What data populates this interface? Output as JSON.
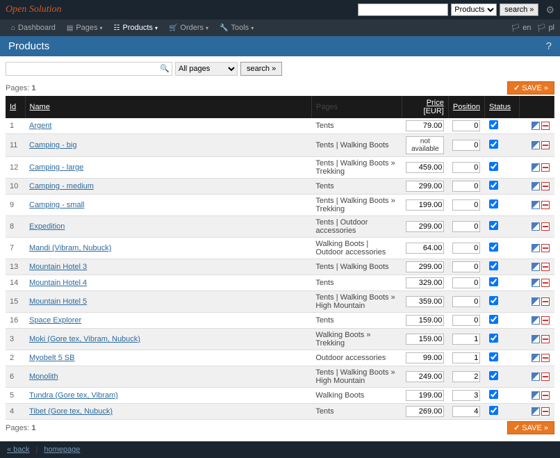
{
  "brand": "Open Solution",
  "top": {
    "search_placeholder": "",
    "type_select": "Products",
    "search_btn": "search »"
  },
  "nav": {
    "items": [
      {
        "label": "Dashboard",
        "dd": false
      },
      {
        "label": "Pages",
        "dd": true
      },
      {
        "label": "Products",
        "dd": true,
        "active": true
      },
      {
        "label": "Orders",
        "dd": true
      },
      {
        "label": "Tools",
        "dd": true
      }
    ],
    "lang": [
      "en",
      "pl"
    ]
  },
  "page": {
    "title": "Products"
  },
  "filter": {
    "pages_select": "All pages",
    "search_btn": "search »"
  },
  "pagination": {
    "label": "Pages:",
    "current": "1"
  },
  "save_btn": "SAVE »",
  "table": {
    "headers": {
      "id": "Id",
      "name": "Name",
      "pages": "Pages",
      "price": "Price",
      "currency": "[EUR]",
      "position": "Position",
      "status": "Status"
    },
    "rows": [
      {
        "id": "1",
        "name": "Argent",
        "pages": "Tents",
        "price": "79.00",
        "position": "0",
        "status": true
      },
      {
        "id": "11",
        "name": "Camping - big",
        "pages": "Tents | Walking Boots",
        "price_na": "not available",
        "position": "0",
        "status": true
      },
      {
        "id": "12",
        "name": "Camping - large",
        "pages": "Tents | Walking Boots » Trekking",
        "price": "459.00",
        "position": "0",
        "status": true
      },
      {
        "id": "10",
        "name": "Camping - medium",
        "pages": "Tents",
        "price": "299.00",
        "position": "0",
        "status": true
      },
      {
        "id": "9",
        "name": "Camping - small",
        "pages": "Tents | Walking Boots » Trekking",
        "price": "199.00",
        "position": "0",
        "status": true
      },
      {
        "id": "8",
        "name": "Expedition",
        "pages": "Tents | Outdoor accessories",
        "price": "299.00",
        "position": "0",
        "status": true
      },
      {
        "id": "7",
        "name": "Mandi (Vibram, Nubuck)",
        "pages": "Walking Boots | Outdoor accessories",
        "price": "64.00",
        "position": "0",
        "status": true
      },
      {
        "id": "13",
        "name": "Mountain Hotel 3",
        "pages": "Tents | Walking Boots",
        "price": "299.00",
        "position": "0",
        "status": true
      },
      {
        "id": "14",
        "name": "Mountain Hotel 4",
        "pages": "Tents",
        "price": "329.00",
        "position": "0",
        "status": true
      },
      {
        "id": "15",
        "name": "Mountain Hotel 5",
        "pages": "Tents | Walking Boots » High Mountain",
        "price": "359.00",
        "position": "0",
        "status": true
      },
      {
        "id": "16",
        "name": "Space Explorer",
        "pages": "Tents",
        "price": "159.00",
        "position": "0",
        "status": true
      },
      {
        "id": "3",
        "name": "Moki (Gore tex, Vibram, Nubuck)",
        "pages": "Walking Boots » Trekking",
        "price": "159.00",
        "position": "1",
        "status": true
      },
      {
        "id": "2",
        "name": "Myobelt 5 SB",
        "pages": "Outdoor accessories",
        "price": "99.00",
        "position": "1",
        "status": true
      },
      {
        "id": "6",
        "name": "Monolith",
        "pages": "Tents | Walking Boots » High Mountain",
        "price": "249.00",
        "position": "2",
        "status": true
      },
      {
        "id": "5",
        "name": "Tundra (Gore tex, Vibram)",
        "pages": "Walking Boots",
        "price": "199.00",
        "position": "3",
        "status": true
      },
      {
        "id": "4",
        "name": "Tibet (Gore tex, Nubuck)",
        "pages": "Tents",
        "price": "269.00",
        "position": "4",
        "status": true
      }
    ]
  },
  "footer": {
    "back": "« back",
    "home": "homepage"
  }
}
